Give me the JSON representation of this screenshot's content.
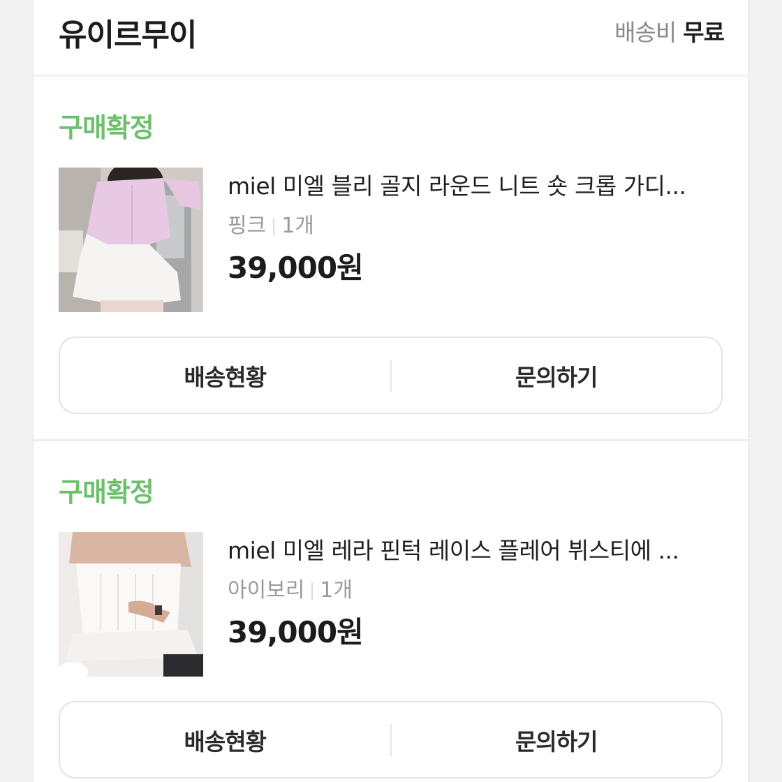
{
  "header": {
    "store_name": "유이르무이",
    "shipping_label": "배송비",
    "shipping_value": "무료"
  },
  "orders": [
    {
      "status": "구매확정",
      "title": "miel 미엘 블리 골지 라운드 니트 숏 크롭 가디...",
      "option_color": "핑크",
      "option_qty": "1개",
      "price": "39,000원",
      "buttons": {
        "delivery": "배송현황",
        "inquiry": "문의하기"
      }
    },
    {
      "status": "구매확정",
      "title": "miel 미엘 레라 핀턱 레이스 플레어 뷔스티에 ...",
      "option_color": "아이보리",
      "option_qty": "1개",
      "price": "39,000원",
      "buttons": {
        "delivery": "배송현황",
        "inquiry": "문의하기"
      }
    }
  ],
  "colors": {
    "status_green": "#6cc06c",
    "muted_text": "#9a9a9c",
    "border": "#e3e3e5"
  }
}
